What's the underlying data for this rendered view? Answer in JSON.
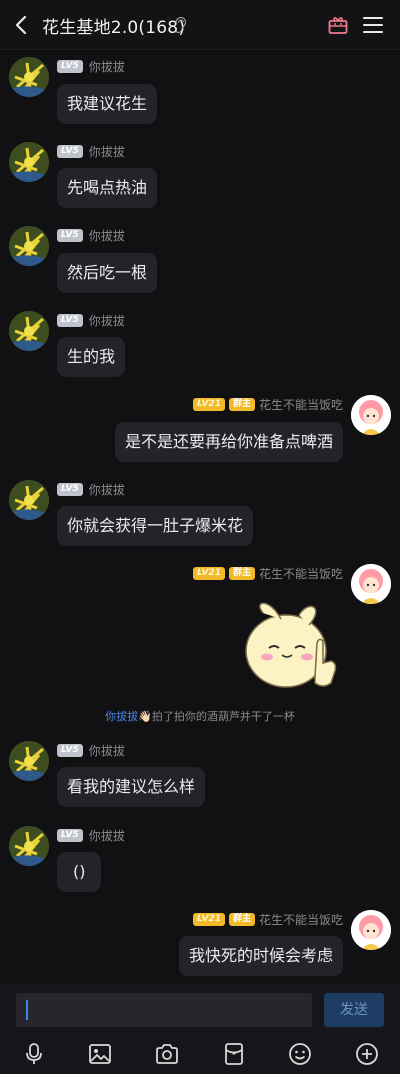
{
  "header": {
    "title": "花生基地2.0(168)"
  },
  "left_user": {
    "level": "LV5",
    "name": "你拔拔"
  },
  "right_user": {
    "level": "LV21",
    "role": "群主",
    "name": "花生不能当饭吃"
  },
  "messages": [
    {
      "text": "我建议花生"
    },
    {
      "text": "先喝点热油"
    },
    {
      "text": "然后吃一根"
    },
    {
      "text": "生的我"
    },
    {
      "text": "是不是还要再给你准备点啤酒"
    },
    {
      "text": "你就会获得一肚子爆米花"
    },
    {
      "text": "看我的建议怎么样"
    },
    {
      "text": "()"
    },
    {
      "text": "我快死的时候会考虑"
    }
  ],
  "system": {
    "actor": "你拔拔",
    "emoji": "👋🏻",
    "action": "拍了拍你的酒葫芦并干了一杯"
  },
  "input": {
    "send_label": "发送"
  },
  "icons": [
    "back-arrow-icon",
    "ear-icon",
    "gift-icon",
    "menu-icon",
    "microphone-icon",
    "image-icon",
    "camera-icon",
    "red-packet-icon",
    "emoji-icon",
    "plus-icon"
  ],
  "colors": {
    "background": "#111113",
    "bubble": "#232329",
    "level_gray": "#bfc3cc",
    "level_gold": "#f2b928",
    "link_blue": "#4a83e0",
    "send_button": "#1c3c63"
  }
}
